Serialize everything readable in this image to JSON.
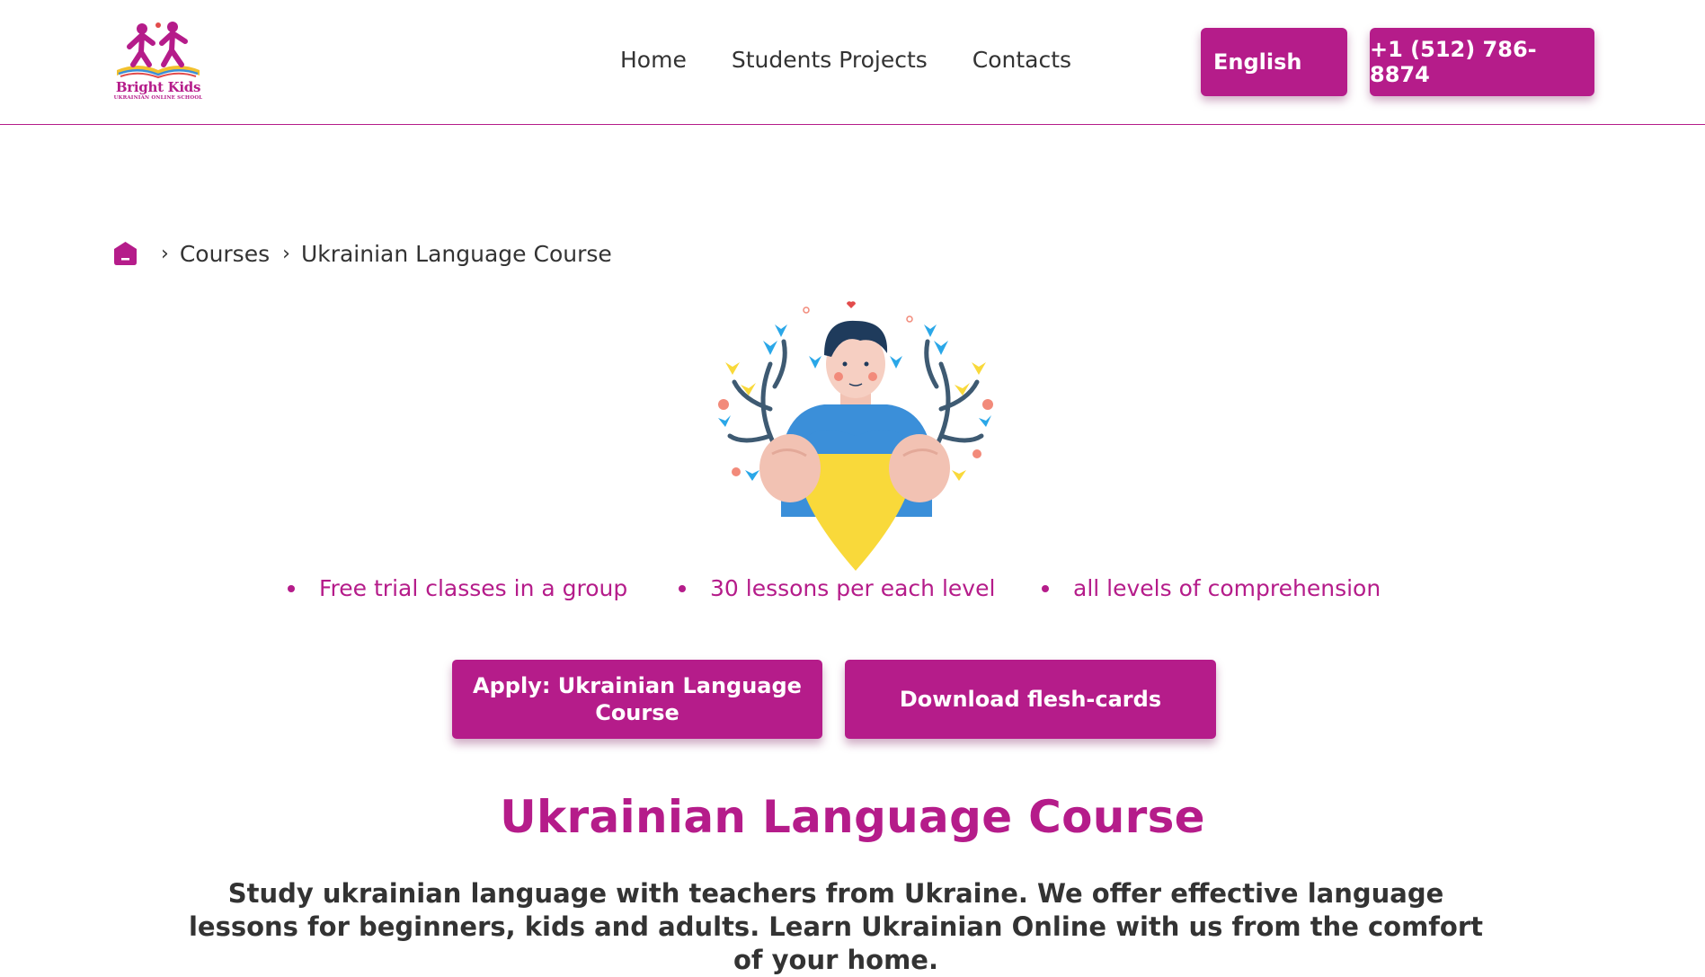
{
  "logo": {
    "name": "Bright Kids",
    "tagline": "UKRAINIAN ONLINE SCHOOL"
  },
  "nav": {
    "items": [
      "Home",
      "Students Projects",
      "Contacts"
    ]
  },
  "header": {
    "language_label": "English",
    "phone_label": "+1 (512) 786-8874"
  },
  "breadcrumb": {
    "items": [
      "Courses",
      "Ukrainian Language Course"
    ]
  },
  "features": [
    "Free trial classes in a group",
    "30 lessons per each level",
    "all levels of comprehension"
  ],
  "cta": {
    "apply_label": "Apply: Ukrainian Language Course",
    "download_label": "Download flesh-cards"
  },
  "main": {
    "title": "Ukrainian Language Course",
    "lead": "Study ukrainian language with teachers from Ukraine. We offer effective language lessons for beginners, kids and adults. Learn Ukrainian Online with us from the comfort of your home."
  },
  "colors": {
    "accent": "#b51c8a",
    "ukraine_blue": "#3b8fd9",
    "ukraine_yellow": "#f9d93a"
  }
}
